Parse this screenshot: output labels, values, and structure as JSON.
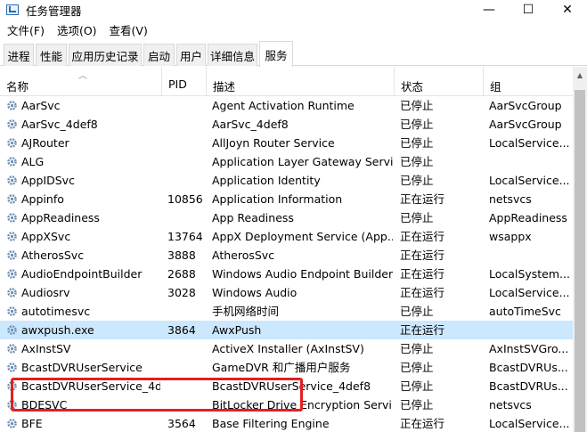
{
  "window": {
    "title": "任务管理器",
    "controls": {
      "minimize": "—",
      "maximize": "☐",
      "close": "✕"
    }
  },
  "menu": [
    "文件(F)",
    "选项(O)",
    "查看(V)"
  ],
  "tabs": [
    "进程",
    "性能",
    "应用历史记录",
    "启动",
    "用户",
    "详细信息",
    "服务"
  ],
  "active_tab": "服务",
  "columns": {
    "name": "名称",
    "pid": "PID",
    "desc": "描述",
    "status": "状态",
    "group": "组"
  },
  "rows": [
    {
      "name": "AarSvc",
      "pid": "",
      "desc": "Agent Activation Runtime",
      "status": "已停止",
      "group": "AarSvcGroup"
    },
    {
      "name": "AarSvc_4def8",
      "pid": "",
      "desc": "AarSvc_4def8",
      "status": "已停止",
      "group": "AarSvcGroup"
    },
    {
      "name": "AJRouter",
      "pid": "",
      "desc": "AllJoyn Router Service",
      "status": "已停止",
      "group": "LocalService..."
    },
    {
      "name": "ALG",
      "pid": "",
      "desc": "Application Layer Gateway Servi...",
      "status": "已停止",
      "group": ""
    },
    {
      "name": "AppIDSvc",
      "pid": "",
      "desc": "Application Identity",
      "status": "已停止",
      "group": "LocalService..."
    },
    {
      "name": "Appinfo",
      "pid": "10856",
      "desc": "Application Information",
      "status": "正在运行",
      "group": "netsvcs"
    },
    {
      "name": "AppReadiness",
      "pid": "",
      "desc": "App Readiness",
      "status": "已停止",
      "group": "AppReadiness"
    },
    {
      "name": "AppXSvc",
      "pid": "13764",
      "desc": "AppX Deployment Service (App...",
      "status": "正在运行",
      "group": "wsappx"
    },
    {
      "name": "AtherosSvc",
      "pid": "3888",
      "desc": "AtherosSvc",
      "status": "正在运行",
      "group": ""
    },
    {
      "name": "AudioEndpointBuilder",
      "pid": "2688",
      "desc": "Windows Audio Endpoint Builder",
      "status": "正在运行",
      "group": "LocalSystem..."
    },
    {
      "name": "Audiosrv",
      "pid": "3028",
      "desc": "Windows Audio",
      "status": "正在运行",
      "group": "LocalService..."
    },
    {
      "name": "autotimesvc",
      "pid": "",
      "desc": "手机网络时间",
      "status": "已停止",
      "group": "autoTimeSvc"
    },
    {
      "name": "awxpush.exe",
      "pid": "3864",
      "desc": "AwxPush",
      "status": "正在运行",
      "group": "",
      "selected": true
    },
    {
      "name": "AxInstSV",
      "pid": "",
      "desc": "ActiveX Installer (AxInstSV)",
      "status": "已停止",
      "group": "AxInstSVGro..."
    },
    {
      "name": "BcastDVRUserService",
      "pid": "",
      "desc": "GameDVR 和广播用户服务",
      "status": "已停止",
      "group": "BcastDVRUs..."
    },
    {
      "name": "BcastDVRUserService_4d...",
      "pid": "",
      "desc": "BcastDVRUserService_4def8",
      "status": "已停止",
      "group": "BcastDVRUs..."
    },
    {
      "name": "BDESVC",
      "pid": "",
      "desc": "BitLocker Drive Encryption Servi...",
      "status": "已停止",
      "group": "netsvcs"
    },
    {
      "name": "BFE",
      "pid": "3564",
      "desc": "Base Filtering Engine",
      "status": "正在运行",
      "group": "LocalService..."
    }
  ],
  "scrollbar": {
    "up_arrow": "▲"
  },
  "colors": {
    "selected_row": "#cce8ff",
    "highlight_box": "#e02020",
    "gear_icon": "#6b8fb5"
  },
  "icons": {
    "service_row": "gear-icon",
    "title": "task-manager-icon"
  }
}
